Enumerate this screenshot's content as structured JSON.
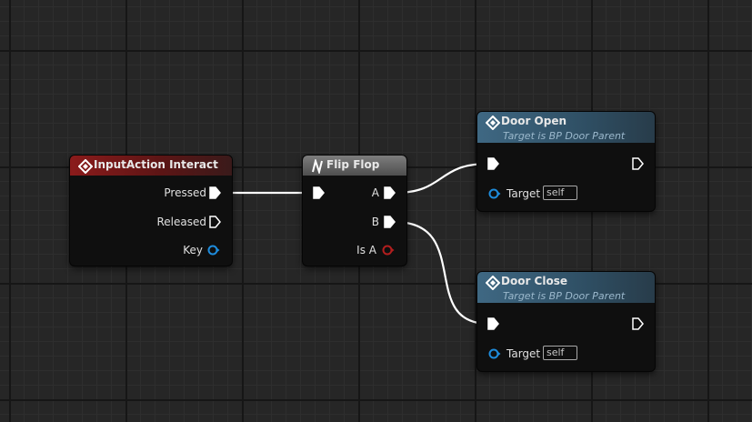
{
  "nodes": {
    "input_action": {
      "title": "InputAction Interact",
      "pins": {
        "pressed": "Pressed",
        "released": "Released",
        "key": "Key"
      }
    },
    "flip_flop": {
      "title": "Flip Flop",
      "pins": {
        "a": "A",
        "b": "B",
        "is_a": "Is A"
      }
    },
    "door_open": {
      "title": "Door Open",
      "subtitle": "Target is BP Door Parent",
      "target_label": "Target",
      "target_value": "self"
    },
    "door_close": {
      "title": "Door Close",
      "subtitle": "Target is BP Door Parent",
      "target_label": "Target",
      "target_value": "self"
    }
  },
  "icons": {
    "event": "event-diamond-icon",
    "macro": "macro-n-icon",
    "function": "function-f-icon",
    "exec_pin": "exec-pin-icon",
    "struct_pin": "struct-pin-icon",
    "bool_pin": "bool-pin-icon",
    "object_pin": "object-pin-icon"
  },
  "colors": {
    "event_header": "#8b1b1b",
    "function_header": "#3f6883",
    "macro_header": "#6a6a6a",
    "exec_wire": "#ffffff",
    "struct_pin": "#1e8cdc",
    "bool_pin": "#b21e1e",
    "object_pin": "#1e8cdc"
  }
}
